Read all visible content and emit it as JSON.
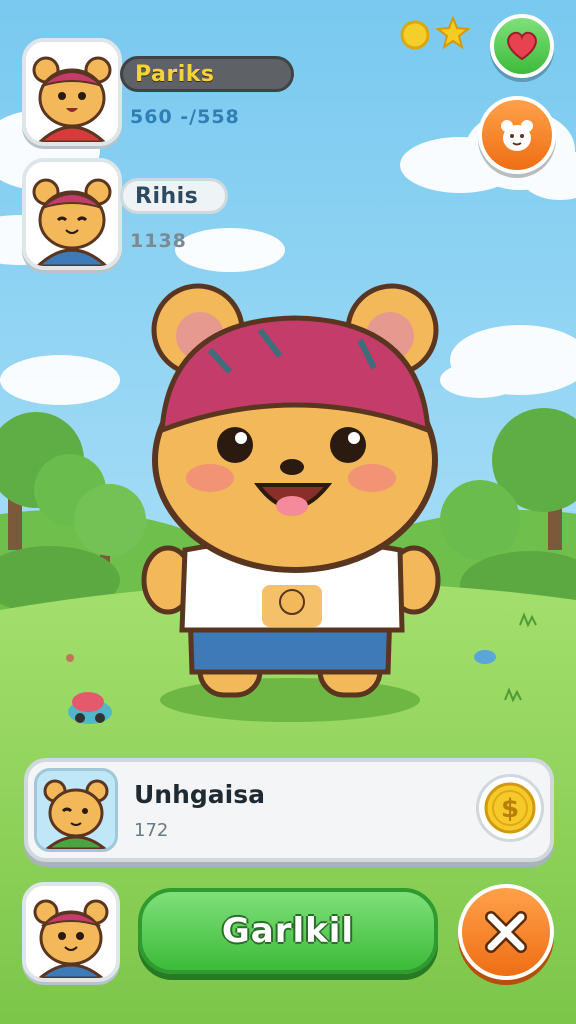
{
  "players": [
    {
      "name": "Pariks",
      "score": "560 -/558"
    },
    {
      "name": "Rihis",
      "score": "1138"
    }
  ],
  "panel": {
    "title": "Unhgaisa",
    "subtitle": "172"
  },
  "buttons": {
    "play_label": "Garlkil"
  },
  "icons": {
    "hud": [
      "coin-icon",
      "star-icon",
      "heart-icon",
      "character-icon",
      "dollar-coin-icon",
      "close-icon"
    ]
  },
  "colors": {
    "sky": "#8fd3f4",
    "grass": "#8fd35a",
    "green_button": "#3dbb3a",
    "orange_button": "#ef6e14",
    "name_bar_dark": "#5e6266",
    "name_text_yellow": "#f7d23a"
  }
}
